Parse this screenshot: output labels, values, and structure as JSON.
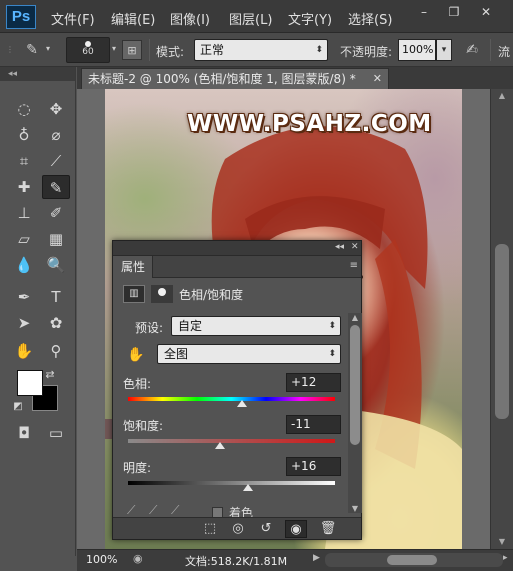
{
  "app": {
    "logo": "Ps"
  },
  "menu": {
    "items": [
      {
        "label": "文件(F)"
      },
      {
        "label": "编辑(E)"
      },
      {
        "label": "图像(I)"
      },
      {
        "label": "图层(L)"
      },
      {
        "label": "文字(Y)"
      },
      {
        "label": "选择(S)"
      }
    ],
    "minimize": "–",
    "restore": "❐",
    "close": "✕"
  },
  "options": {
    "brush_size": "60",
    "mode_label": "模式:",
    "mode_value": "正常",
    "opacity_label": "不透明度:",
    "opacity_value": "100%",
    "flow_label_partial": "流"
  },
  "toolbox": {
    "collapse": "◂◂"
  },
  "document": {
    "tab_title": "未标题-2 @ 100% (色相/饱和度 1, 图层蒙版/8) *",
    "watermark": "WWW.PSAHZ.COM"
  },
  "status": {
    "zoom": "100%",
    "doc_info": "文档:518.2K/1.81M"
  },
  "properties_panel": {
    "collapse": "◂◂",
    "close": "✕",
    "tab_label": "属性",
    "menu_icon": "≡",
    "adjustment_title": "色相/饱和度",
    "preset_label": "预设:",
    "preset_value": "自定",
    "channel_value": "全图",
    "hue": {
      "label": "色相:",
      "value": "+12",
      "position": 0.55
    },
    "saturation": {
      "label": "饱和度:",
      "value": "-11",
      "position": 0.445
    },
    "lightness": {
      "label": "明度:",
      "value": "+16",
      "position": 0.58
    },
    "colorize_label": "着色"
  },
  "colors": {
    "foreground": "#ffffff",
    "background": "#000000",
    "accent": "#3a86c8"
  }
}
